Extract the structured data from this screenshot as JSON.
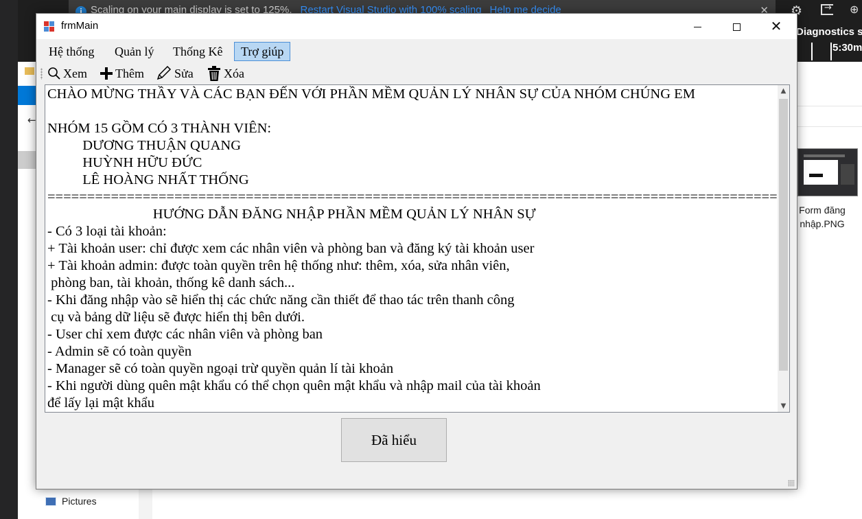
{
  "background": {
    "infobar": {
      "message": "Scaling on your main display is set to 125%.",
      "link_restart": "Restart Visual Studio with 100% scaling",
      "link_help": "Help me decide",
      "close": "✕"
    },
    "diagnostics_label": "Diagnostics ses",
    "time_label": "5:30m",
    "thumbnail_caption": "Form đăng nhập.PNG",
    "pictures_label": "Pictures"
  },
  "window": {
    "title": "frmMain",
    "minimize": "",
    "maximize": "",
    "close": "✕"
  },
  "menu": {
    "items": [
      {
        "label": "Hệ thống"
      },
      {
        "label": "Quản lý"
      },
      {
        "label": "Thống Kê"
      },
      {
        "label": "Trợ giúp"
      }
    ]
  },
  "toolbar": {
    "view_label": "Xem",
    "add_label": "Thêm",
    "edit_label": "Sửa",
    "delete_label": "Xóa"
  },
  "help_text": {
    "lines": [
      "CHÀO MỪNG THẦY VÀ CÁC BẠN ĐẾN VỚI PHẦN MỀM QUẢN LÝ NHÂN SỰ CỦA NHÓM CHÚNG EM",
      "",
      "NHÓM 15 GỒM CÓ 3 THÀNH VIÊN:",
      "          DƯƠNG THUẬN QUANG",
      "          HUỲNH HỮU ĐỨC",
      "          LÊ HOÀNG NHẤT THỐNG",
      "=================================================================================================",
      "                              HƯỚNG DẪN ĐĂNG NHẬP PHẦN MỀM QUẢN LÝ NHÂN SỰ",
      "- Có 3 loại tài khoản:",
      "+ Tài khoản user: chỉ được xem các nhân viên và phòng ban và đăng ký tài khoản user",
      "+ Tài khoản admin: được toàn quyền trên hệ thống như: thêm, xóa, sửa nhân viên,",
      " phòng ban, tài khoản, thống kê danh sách...",
      "- Khi đăng nhập vào sẽ hiển thị các chức năng cần thiết để thao tác trên thanh công",
      " cụ và bảng dữ liệu sẽ được hiển thị bên dưới.",
      "- User chỉ xem được các nhân viên và phòng ban",
      "- Admin sẽ có toàn quyền",
      "- Manager sẽ có toàn quyền ngoại trừ quyền quản lí tài khoản",
      "- Khi người dùng quên mật khẩu có thể chọn quên mật khẩu và nhập mail của tài khoản",
      "để lấy lại mật khẩu"
    ]
  },
  "scrollbar": {
    "up": "▲",
    "down": "▼"
  },
  "confirm_button": {
    "label": "Đã hiểu"
  },
  "colors": {
    "window_bg": "#f0f0f0",
    "menu_active_bg": "#b8d7f3",
    "menu_active_border": "#4c8fd6",
    "infobar_link": "#3794ff"
  }
}
